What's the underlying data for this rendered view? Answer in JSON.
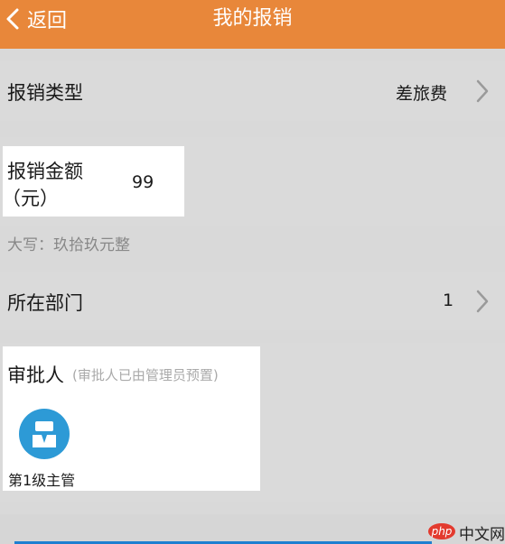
{
  "header": {
    "back_label": "返回",
    "title": "我的报销",
    "bg_color": "#e8873a"
  },
  "rows": {
    "type_label": "报销类型",
    "type_value": "差旅费",
    "amount_label_line1": "报销金额",
    "amount_label_line2": "（元）",
    "amount_value": "99",
    "amount_words": "大写：玖拾玖元整",
    "dept_label": "所在部门",
    "dept_value": "1"
  },
  "approver": {
    "title": "审批人",
    "subtitle": "(审批人已由管理员预置)",
    "role": "第1级主管",
    "avatar_icon": "user-icon",
    "avatar_color": "#2d9ad6"
  },
  "watermark": {
    "badge": "php",
    "text": "中文网"
  }
}
